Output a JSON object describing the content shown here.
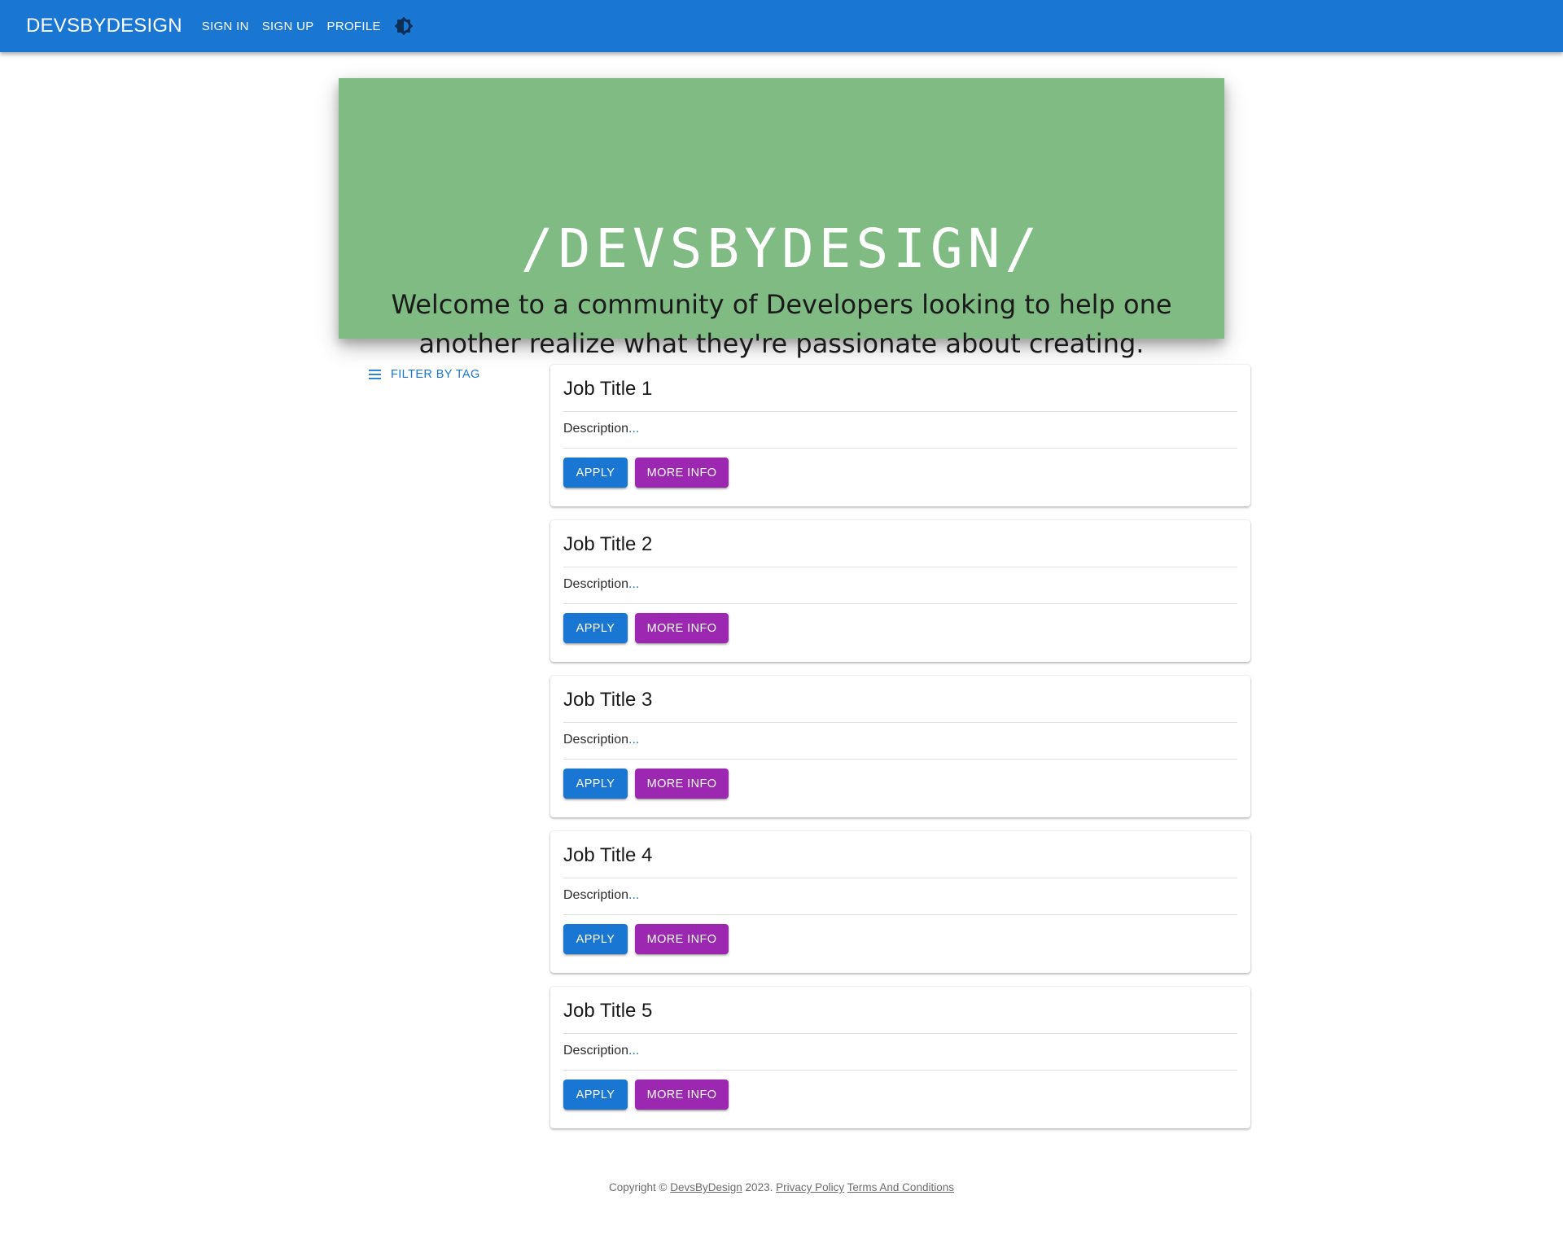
{
  "header": {
    "brand": "DEVSBYDESIGN",
    "nav": [
      "SIGN IN",
      "SIGN UP",
      "PROFILE"
    ],
    "theme_icon": "brightness-icon",
    "bar_color": "#1976d2"
  },
  "hero": {
    "logo_text": "/DEVSBYDESIGN/",
    "tagline": "Welcome to a community of Developers looking to help one another realize what they're passionate about creating.",
    "background": "#7fbb83"
  },
  "filter": {
    "label": "FILTER BY TAG",
    "icon": "menu-icon"
  },
  "jobs": [
    {
      "title": "Job Title 1",
      "description": "Description",
      "ellipsis": "...",
      "apply": "APPLY",
      "more": "MORE INFO"
    },
    {
      "title": "Job Title 2",
      "description": "Description",
      "ellipsis": "...",
      "apply": "APPLY",
      "more": "MORE INFO"
    },
    {
      "title": "Job Title 3",
      "description": "Description",
      "ellipsis": "...",
      "apply": "APPLY",
      "more": "MORE INFO"
    },
    {
      "title": "Job Title 4",
      "description": "Description",
      "ellipsis": "...",
      "apply": "APPLY",
      "more": "MORE INFO"
    },
    {
      "title": "Job Title 5",
      "description": "Description",
      "ellipsis": "...",
      "apply": "APPLY",
      "more": "MORE INFO"
    }
  ],
  "colors": {
    "primary": "#1976d2",
    "secondary": "#9c27b0"
  },
  "footer": {
    "prefix": "Copyright © ",
    "brand_link": "DevsByDesign",
    "year": " 2023.",
    "privacy": "Privacy Policy",
    "terms": "Terms And Conditions"
  }
}
